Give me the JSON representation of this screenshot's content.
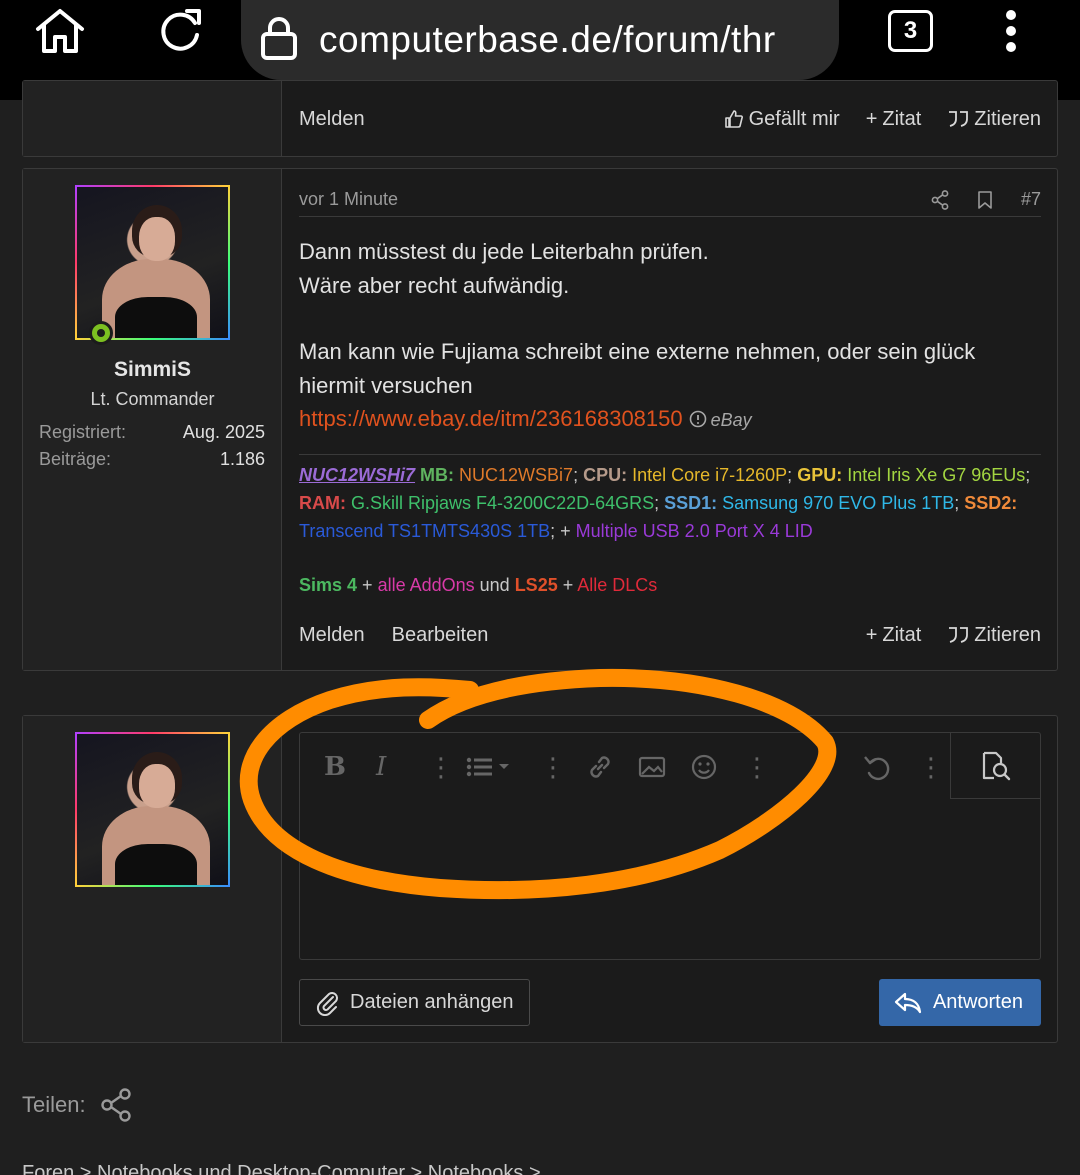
{
  "browser": {
    "url": "computerbase.de/forum/thr",
    "tab_count": "3",
    "icons": [
      "home-icon",
      "reload-icon",
      "lock-icon",
      "tabs-icon",
      "more-vert-icon"
    ]
  },
  "prev_post": {
    "actions_left": [
      "Melden"
    ],
    "actions_right": [
      "Gefällt mir",
      "Zitat",
      "Zitieren"
    ]
  },
  "post": {
    "user": {
      "name": "SimmiS",
      "title": "Lt. Commander",
      "stats": [
        {
          "label": "Registriert:",
          "value": "Aug. 2025"
        },
        {
          "label": "Beiträge:",
          "value": "1.186"
        }
      ],
      "online": true
    },
    "time": "vor 1 Minute",
    "number": "#7",
    "lines": [
      "Dann müsstest du jede Leiterbahn prüfen.",
      "Wäre aber recht aufwändig.",
      "Man kann wie Fujiama schreibt eine externe nehmen, oder sein glück hiermit versuchen"
    ],
    "link": "https://www.ebay.de/itm/236168308150",
    "link_source": "eBay",
    "signature": {
      "line1": [
        {
          "t": "NUC12WSHi7",
          "c": "#9b6bd6"
        },
        {
          "t": " MB:",
          "c": "#5fb35f"
        },
        {
          "t": " NUC12WSBi7",
          "c": "#e07a2a"
        },
        {
          "t": "; ",
          "c": "#c8c8c8"
        },
        {
          "t": "CPU:",
          "c": "#b59a8a"
        },
        {
          "t": " Intel Core i7-1260P",
          "c": "#e6b82a"
        },
        {
          "t": "; ",
          "c": "#c8c8c8"
        },
        {
          "t": "GPU:",
          "c": "#e8c33a"
        },
        {
          "t": " Intel Iris Xe G7 96EUs",
          "c": "#a3d641"
        },
        {
          "t": "; ",
          "c": "#c8c8c8"
        },
        {
          "t": "RAM:",
          "c": "#d84a4a"
        },
        {
          "t": " G.Skill Ripjaws F4-3200C22D-64GRS",
          "c": "#3ec06b"
        },
        {
          "t": "; ",
          "c": "#c8c8c8"
        },
        {
          "t": "SSD1:",
          "c": "#5aa0d8"
        },
        {
          "t": " Samsung 970 EVO Plus 1TB",
          "c": "#2fb8e8"
        },
        {
          "t": "; ",
          "c": "#c8c8c8"
        },
        {
          "t": "SSD2:",
          "c": "#f08a3a"
        },
        {
          "t": " Transcend TS1TMTS430S 1TB",
          "c": "#2a5ad8"
        },
        {
          "t": "; ",
          "c": "#c8c8c8"
        },
        {
          "t": "+ ",
          "c": "#c8c8c8"
        },
        {
          "t": "Multiple USB 2.0 Port X 4 LID",
          "c": "#9a3ad8"
        }
      ],
      "line2": [
        {
          "t": "Sims 4",
          "c": "#4cb860"
        },
        {
          "t": " + ",
          "c": "#c8c8c8"
        },
        {
          "t": "alle AddOns",
          "c": "#d83aa8"
        },
        {
          "t": " und ",
          "c": "#c8c8c8"
        },
        {
          "t": "LS25",
          "c": "#e0502a"
        },
        {
          "t": " + ",
          "c": "#c8c8c8"
        },
        {
          "t": "Alle DLCs",
          "c": "#e02a3a"
        }
      ]
    },
    "actions_left": [
      "Melden",
      "Bearbeiten"
    ],
    "actions_right": [
      "Zitat",
      "Zitieren"
    ]
  },
  "reply": {
    "attach_label": "Dateien anhängen",
    "reply_label": "Antworten"
  },
  "footer": {
    "share_label": "Teilen:",
    "breadcrumb": "Foren  >  Notebooks und Desktop-Computer  >  Notebooks  >"
  },
  "colors": {
    "accent": "#3467a8",
    "link": "#e0521e",
    "online": "#7cc021",
    "scribble": "#ff8c00"
  }
}
